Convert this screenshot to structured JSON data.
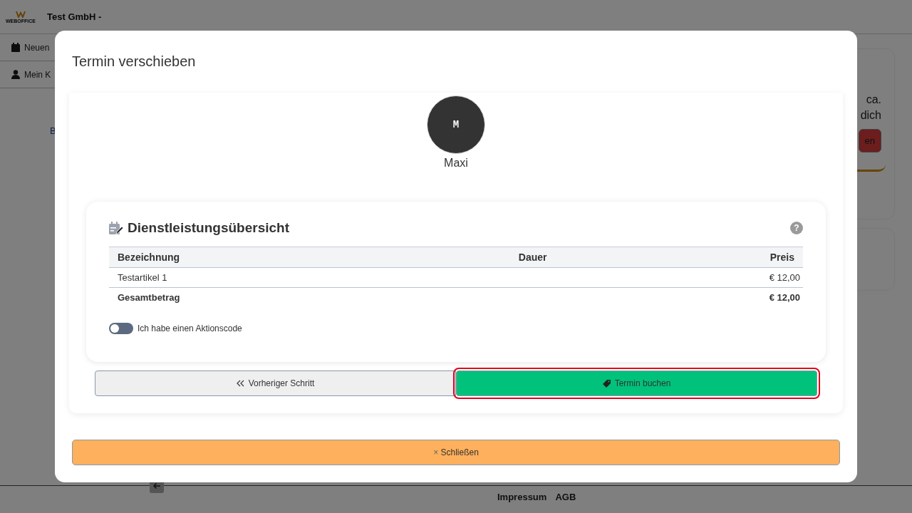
{
  "background_page": {
    "header": {
      "logo_text": "WEBOFFICE",
      "company": "Test GmbH -"
    },
    "sidebar": {
      "items": [
        {
          "label": "Neuen",
          "kind": "calendar"
        },
        {
          "label": "Mein K",
          "kind": "user"
        }
      ]
    },
    "content_fragment": "B",
    "side_card": {
      "lines": [
        "ca.",
        "dich"
      ],
      "button": "en"
    },
    "footer": {
      "links": [
        "Impressum",
        "AGB"
      ]
    }
  },
  "dialog": {
    "title": "Termin verschieben",
    "staff": {
      "initial": "M",
      "name": "Maxi"
    },
    "summary": {
      "title": "Dienstleistungsübersicht",
      "help": "?",
      "table": {
        "columns": [
          "Bezeichnung",
          "Dauer",
          "Preis"
        ],
        "rows": [
          {
            "kind": "item",
            "cells": [
              "Testartikel 1",
              "",
              "€ 12,00"
            ]
          },
          {
            "kind": "total",
            "cells": [
              "Gesamtbetrag",
              "",
              "€ 12,00"
            ]
          }
        ]
      },
      "promo_toggle": {
        "label": "Ich habe einen Aktionscode",
        "on": false
      }
    },
    "buttons": [
      {
        "label": "Vorheriger Schritt",
        "kind": "back",
        "focused": false
      },
      {
        "label": "Termin buchen",
        "kind": "book",
        "focused": true
      }
    ],
    "close": {
      "icon": "×",
      "label": "Schließen"
    }
  }
}
